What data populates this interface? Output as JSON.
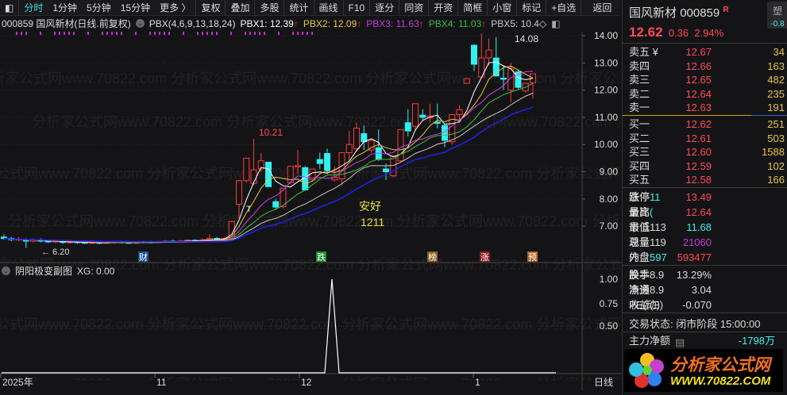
{
  "toolbar": {
    "items": [
      "分时",
      "1分钟",
      "5分钟",
      "15分钟",
      "更多 〉"
    ],
    "buttons": [
      "复权",
      "叠加",
      "多股",
      "统计",
      "画线",
      "F10",
      "逐分",
      "同资",
      "开资",
      "简框",
      "小窗",
      "标记",
      "+自选",
      "返回"
    ]
  },
  "info": {
    "title": "000859 国风新材(日线.前复权)",
    "indicator": "PBX(4,6,9,13,18,24)",
    "pbx1": "PBX1: 12.39",
    "pbx2": "PBX2: 12.09",
    "pbx3": "PBX3: 11.63",
    "pbx4": "PBX4: 11.03",
    "pbx5": "PBX5: 10.4",
    "up": "↑",
    "diamond": "◇"
  },
  "watermark": "分析家公式网www.70822.com",
  "chart_data": {
    "type": "candlestick",
    "price_axis": [
      "14.00",
      "13.00",
      "12.00",
      "11.00",
      "10.00",
      "9.00",
      "8.00",
      "7.00"
    ],
    "ylim": [
      6.0,
      14.1
    ],
    "candles": [
      [
        6.6,
        6.55,
        6.7,
        6.5
      ],
      [
        6.55,
        6.5,
        6.6,
        6.45
      ],
      [
        6.5,
        6.52,
        6.6,
        6.45
      ],
      [
        6.5,
        6.45,
        6.55,
        6.2
      ],
      [
        6.45,
        6.5,
        6.55,
        6.4
      ],
      [
        6.5,
        6.45,
        6.55,
        6.4
      ],
      [
        6.45,
        6.42,
        6.5,
        6.38
      ],
      [
        6.42,
        6.45,
        6.5,
        6.38
      ],
      [
        6.45,
        6.4,
        6.5,
        6.35
      ],
      [
        6.4,
        6.42,
        6.48,
        6.36
      ],
      [
        6.42,
        6.4,
        6.46,
        6.35
      ],
      [
        6.4,
        6.38,
        6.45,
        6.34
      ],
      [
        6.38,
        6.4,
        6.44,
        6.34
      ],
      [
        6.4,
        6.38,
        6.44,
        6.33
      ],
      [
        6.38,
        6.4,
        6.45,
        6.35
      ],
      [
        6.4,
        6.42,
        6.46,
        6.36
      ],
      [
        6.42,
        6.4,
        6.46,
        6.36
      ],
      [
        6.4,
        6.38,
        6.44,
        6.34
      ],
      [
        6.38,
        6.4,
        6.44,
        6.35
      ],
      [
        6.4,
        6.42,
        6.47,
        6.36
      ],
      [
        6.42,
        6.4,
        6.46,
        6.36
      ],
      [
        6.4,
        6.42,
        6.46,
        6.37
      ],
      [
        6.42,
        6.45,
        6.5,
        6.4
      ],
      [
        6.45,
        6.42,
        6.5,
        6.4
      ],
      [
        6.42,
        6.45,
        6.5,
        6.4
      ],
      [
        6.45,
        6.48,
        6.52,
        6.42
      ],
      [
        6.48,
        6.45,
        6.52,
        6.42
      ],
      [
        6.45,
        6.5,
        6.55,
        6.42
      ],
      [
        6.5,
        6.55,
        6.7,
        6.45
      ],
      [
        6.55,
        6.5,
        6.6,
        6.45
      ],
      [
        6.5,
        6.55,
        6.6,
        6.45
      ],
      [
        6.54,
        7.17,
        7.2,
        6.5
      ],
      [
        7.8,
        8.67,
        8.7,
        7.3
      ],
      [
        8.67,
        9.5,
        9.5,
        8.6
      ],
      [
        8.57,
        9.07,
        10.21,
        8.5
      ],
      [
        9.1,
        9.4,
        9.7,
        9.0
      ],
      [
        9.35,
        8.45,
        9.35,
        8.45
      ],
      [
        7.9,
        7.7,
        8.0,
        7.6
      ],
      [
        7.72,
        8.4,
        8.4,
        7.65
      ],
      [
        8.6,
        9.2,
        9.2,
        8.55
      ],
      [
        9.18,
        9.22,
        9.8,
        8.9
      ],
      [
        9.15,
        8.33,
        9.2,
        8.3
      ],
      [
        8.7,
        9.1,
        9.1,
        8.65
      ],
      [
        9.45,
        9.3,
        9.7,
        9.1
      ],
      [
        9.67,
        9.06,
        9.85,
        8.95
      ],
      [
        8.7,
        8.8,
        9.2,
        8.65
      ],
      [
        8.74,
        9.7,
        9.7,
        8.5
      ],
      [
        9.7,
        10.0,
        10.5,
        9.4
      ],
      [
        9.85,
        10.6,
        10.8,
        9.75
      ],
      [
        10.4,
        10.1,
        10.7,
        9.8
      ],
      [
        9.8,
        10.15,
        10.2,
        9.7
      ],
      [
        9.88,
        9.45,
        10.55,
        9.4
      ],
      [
        9.1,
        9.0,
        9.3,
        8.7
      ],
      [
        8.85,
        9.58,
        9.6,
        8.8
      ],
      [
        9.4,
        10.55,
        10.55,
        9.35
      ],
      [
        10.8,
        10.5,
        11.3,
        10.3
      ],
      [
        10.67,
        11.5,
        11.5,
        10.5
      ],
      [
        11.08,
        11.0,
        11.3,
        10.9
      ],
      [
        10.98,
        11.05,
        11.5,
        10.8
      ],
      [
        10.82,
        10.78,
        11.5,
        10.6
      ],
      [
        10.7,
        10.15,
        10.75,
        9.9
      ],
      [
        10.1,
        11.1,
        11.1,
        10.0
      ],
      [
        11.1,
        11.28,
        11.45,
        10.9
      ],
      [
        12.25,
        12.42,
        12.42,
        12.25
      ],
      [
        13.65,
        12.95,
        13.65,
        12.7
      ],
      [
        12.48,
        13.18,
        14.08,
        12.48
      ],
      [
        13.18,
        13.47,
        13.9,
        12.9
      ],
      [
        13.18,
        12.52,
        13.95,
        12.5
      ],
      [
        12.44,
        12.4,
        12.9,
        12.0
      ],
      [
        12.0,
        12.78,
        13.0,
        11.55
      ],
      [
        12.67,
        12.1,
        12.75,
        12.05
      ],
      [
        11.97,
        12.25,
        12.25,
        11.9
      ],
      [
        12.27,
        12.6,
        12.6,
        11.68
      ]
    ],
    "ma_periods": [
      4,
      6,
      9,
      13,
      18,
      24
    ],
    "ma_colors": [
      "#ffffff",
      "#e8c547",
      "#d040e0",
      "#40c040",
      "#c8c8c8",
      "#2020e0"
    ],
    "annotations": {
      "high": "10.21",
      "peak": "14.08",
      "low": "6.20",
      "t_mark": "T",
      "name": "安好",
      "date": "1211"
    },
    "signals": [
      {
        "label": "财",
        "color": "#1d4f8a"
      },
      {
        "label": "跌",
        "color": "#1b8a2a"
      },
      {
        "label": "榜",
        "color": "#8a5a20"
      },
      {
        "label": "涨",
        "color": "#8a1a1a"
      },
      {
        "label": "预",
        "color": "#b06020"
      }
    ]
  },
  "sub": {
    "title": "阴阳极变副图",
    "xg": "XG: 0.00",
    "axis": [
      "1.00",
      "0.75",
      "0.50"
    ],
    "spike_index": 45
  },
  "dates": {
    "labels": [
      "2025年",
      "11",
      "12",
      "1"
    ],
    "period": "日线"
  },
  "rp": {
    "name": "国风新材",
    "code": "000859",
    "badge": "R",
    "tab": "塑",
    "price": "12.62",
    "change": "0.36",
    "pct": "2.94%",
    "side_val": "-0.8",
    "sell": [
      {
        "l": "卖五 ¥",
        "p": "12.67",
        "v": "34"
      },
      {
        "l": "卖四",
        "p": "12.66",
        "v": "163"
      },
      {
        "l": "卖三",
        "p": "12.65",
        "v": "482"
      },
      {
        "l": "卖二",
        "p": "12.64",
        "v": "235"
      },
      {
        "l": "卖一",
        "p": "12.63",
        "v": "191"
      }
    ],
    "buy": [
      {
        "l": "买一",
        "p": "12.62",
        "v": "251"
      },
      {
        "l": "买二",
        "p": "12.61",
        "v": "503"
      },
      {
        "l": "买三",
        "p": "12.60",
        "v": "1588"
      },
      {
        "l": "买四",
        "p": "12.59",
        "v": "102"
      },
      {
        "l": "买五",
        "p": "12.58",
        "v": "166"
      }
    ],
    "stats": [
      {
        "l": "涨停",
        "v": "13.49",
        "c": "red",
        "l2": "跌停",
        "v2": "11",
        "c2": "cyan"
      },
      {
        "l": "最高",
        "v": "12.64",
        "c": "red",
        "l2": "量比",
        "v2": "(",
        "c2": "cyan"
      },
      {
        "l": "最低",
        "v": "11.68",
        "c": "cyan",
        "l2": "市值",
        "v2": "113",
        "c2": "wht"
      },
      {
        "l": "现量",
        "v": "21060",
        "c": "mag",
        "l2": "总量",
        "v2": "119",
        "c2": "wht"
      },
      {
        "l": "外盘",
        "v": "593477",
        "c": "red",
        "l2": "内盘",
        "v2": "597",
        "c2": "cyan"
      }
    ],
    "stats2": [
      {
        "l": "换手",
        "v": "13.29%",
        "l2": "股本",
        "v2": "8.9"
      },
      {
        "l": "净资",
        "v": "3.04",
        "l2": "流通",
        "v2": "8.9"
      },
      {
        "l": "收益(Ξ)",
        "v": "-0.070",
        "l2": "PE(动)",
        "v2": ""
      }
    ],
    "trade_state": "交易状态: 闭市阶段 15:00:00",
    "main_flow_label": "主力净额",
    "main_flow": "-1798万",
    "logo_cn": "分析家公式网",
    "logo_url": "WWW.70822.COM"
  }
}
